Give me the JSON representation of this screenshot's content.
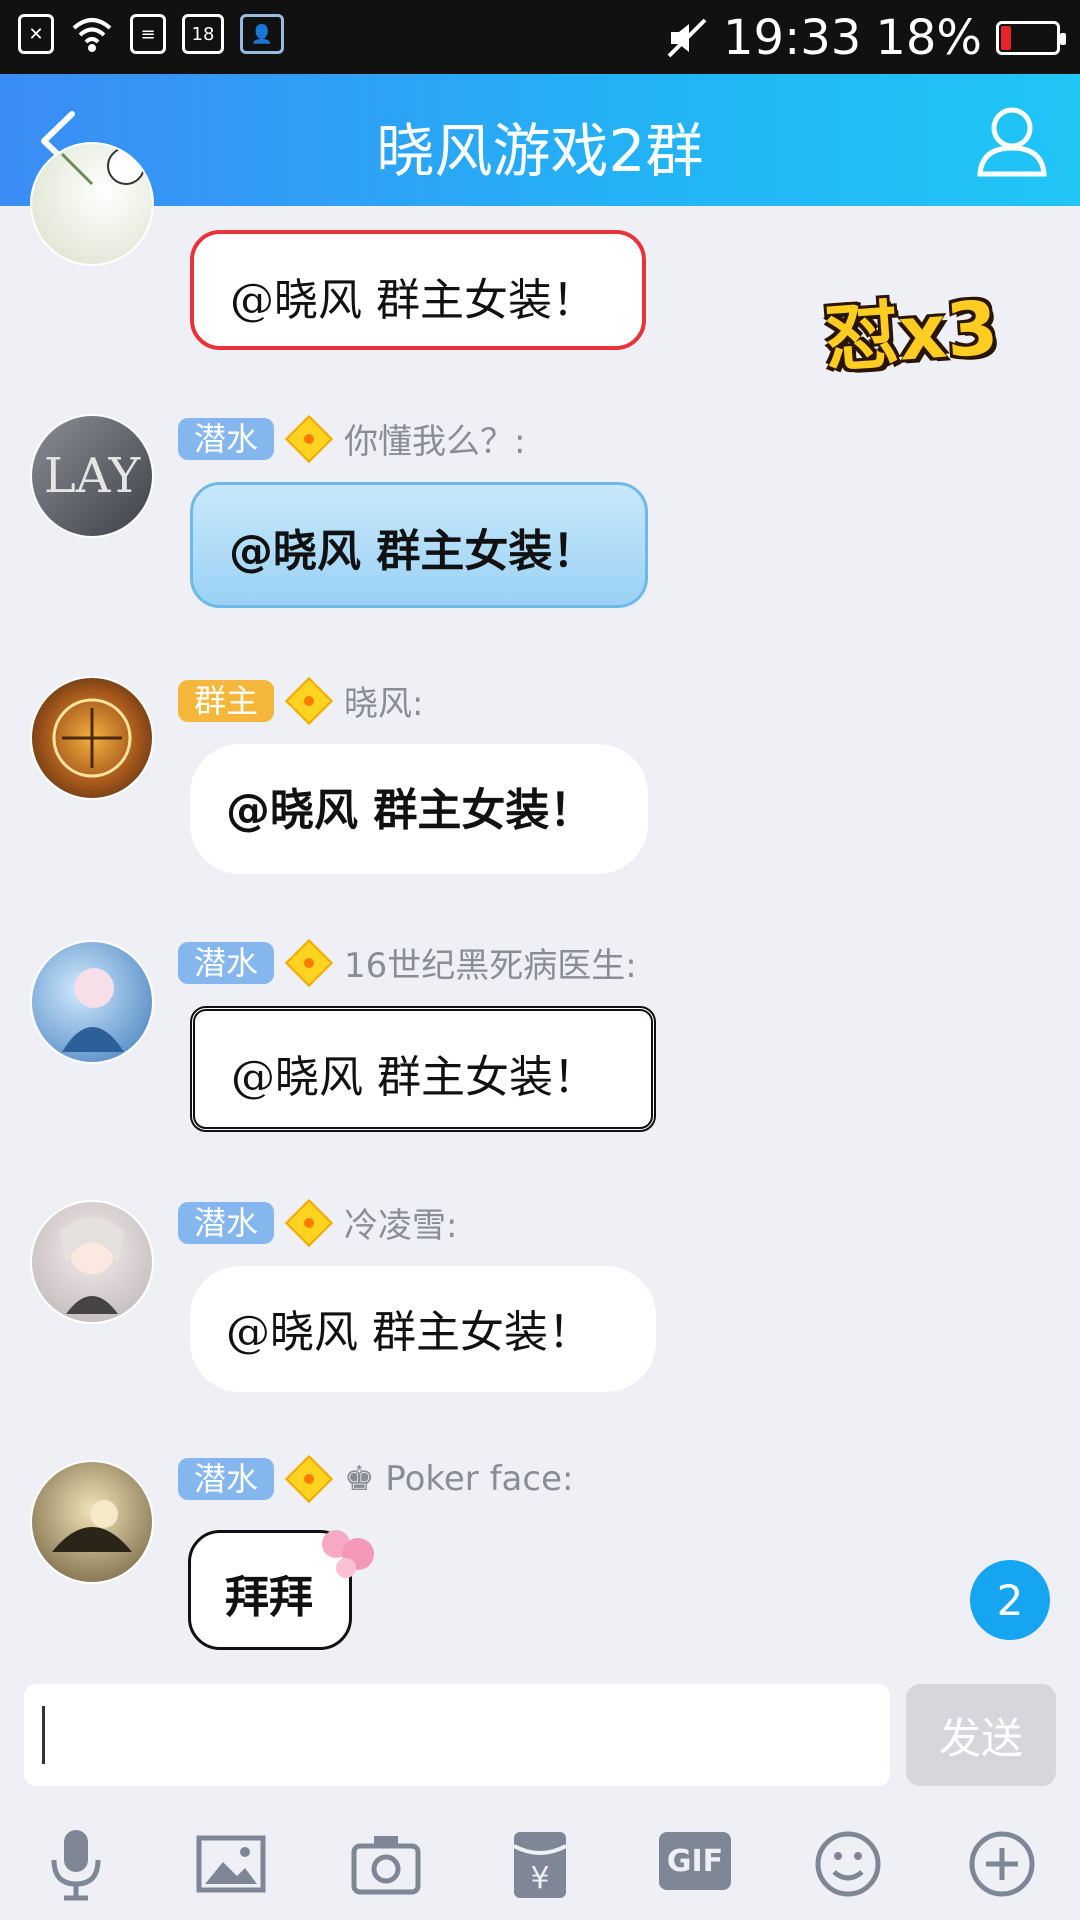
{
  "status_bar": {
    "notification_count": "18",
    "time": "19:33",
    "battery": "18%",
    "battery_level": 0.18
  },
  "header": {
    "title": "晓风游戏2群"
  },
  "sticker": {
    "text": "怼x3"
  },
  "messages": [
    {
      "tag": "",
      "sender": "",
      "text": "@晓风 群主女装！"
    },
    {
      "tag": "潜水",
      "sender": "你懂我么？:",
      "text": "@晓风 群主女装！"
    },
    {
      "tag": "群主",
      "sender": "晓风:",
      "text": "@晓风 群主女装！"
    },
    {
      "tag": "潜水",
      "sender": "16世纪黑死病医生:",
      "text": "@晓风 群主女装！"
    },
    {
      "tag": "潜水",
      "sender": "冷凌雪:",
      "text": "@晓风 群主女装！"
    },
    {
      "tag": "潜水",
      "sender": "♚ Poker face:",
      "text": "拜拜"
    }
  ],
  "unread_badge": "2",
  "composer": {
    "placeholder": "",
    "send_label": "发送"
  },
  "toolbar": {
    "gif_label": "GIF"
  },
  "colors": {
    "header_start": "#3b8cf4",
    "header_end": "#20c6f6",
    "tag_dive": "#85b7ee",
    "tag_owner": "#f4b73b",
    "badge": "#16a6f1"
  }
}
